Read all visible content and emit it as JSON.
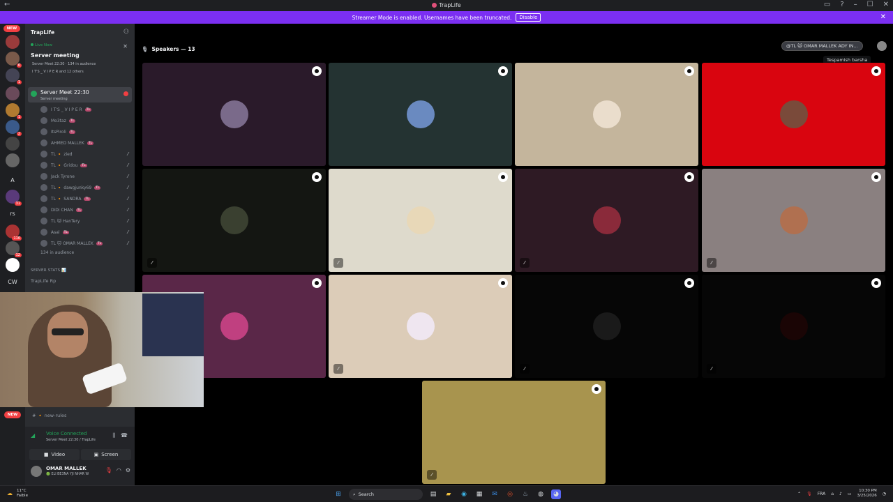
{
  "window": {
    "title": "TrapLife"
  },
  "banner": {
    "text": "Streamer Mode is enabled. Usernames have been truncated.",
    "disable_label": "Disable"
  },
  "guilds": [
    {
      "label": "",
      "badge": "",
      "color": "#9a3b3b"
    },
    {
      "label": "",
      "badge": "6",
      "color": "#7a5a4a"
    },
    {
      "label": "",
      "badge": "1",
      "color": "#445"
    },
    {
      "label": "",
      "badge": "",
      "color": "#6a4a5a"
    },
    {
      "label": "",
      "badge": "1",
      "color": "#b07a30"
    },
    {
      "label": "",
      "badge": "2",
      "color": "#3a5a8a"
    },
    {
      "label": "",
      "badge": "",
      "color": "#444"
    },
    {
      "label": "",
      "badge": "",
      "color": "#666"
    },
    {
      "label": "A",
      "badge": "",
      "color": "#1e1f22"
    },
    {
      "label": "",
      "badge": "31",
      "color": "#5a3a7a"
    },
    {
      "label": "rs",
      "badge": "",
      "color": "#1e1f22"
    },
    {
      "label": "",
      "badge": "116",
      "color": "#a33"
    },
    {
      "label": "",
      "badge": "12",
      "color": "#555"
    },
    {
      "label": "",
      "badge": "",
      "color": "#fff"
    },
    {
      "label": "CW",
      "badge": "",
      "color": "#1e1f22"
    }
  ],
  "guild_new_label": "NEW",
  "sidebar": {
    "server_name": "TrapLife",
    "live_label": "Live Now",
    "stage_title": "Server meeting",
    "stage_meta": "Server Meet 22:30 · 134 in audience",
    "stage_users": "I T'S _ V I P E R and 12 others",
    "voice_channel": {
      "name": "Server Meet 22:30",
      "sub": "Server meeting"
    },
    "members": [
      {
        "name": "I T'S _ V I P E R",
        "tag": "TL",
        "muted": false
      },
      {
        "name": "Mo3taz",
        "tag": "TL",
        "muted": false
      },
      {
        "name": "ItsPiroli",
        "tag": "TL",
        "muted": false
      },
      {
        "name": "AHMED MALLEK",
        "tag": "TL",
        "muted": false
      },
      {
        "name": "TL 🔸 zied",
        "tag": "",
        "muted": true
      },
      {
        "name": "TL 🔸 Gridou",
        "tag": "TL",
        "muted": true
      },
      {
        "name": "Jack Tyrone",
        "tag": "",
        "muted": true
      },
      {
        "name": "TL 🔸 dawgjunky69",
        "tag": "TL",
        "muted": true
      },
      {
        "name": "TL 🔸 SANDRA",
        "tag": "TL",
        "muted": true
      },
      {
        "name": "DiDi CHAN",
        "tag": "TL",
        "muted": true
      },
      {
        "name": "TL 🐱 HanTery",
        "tag": "",
        "muted": true
      },
      {
        "name": "Asal",
        "tag": "TL",
        "muted": true
      },
      {
        "name": "TL 🐱 OMAR MALLEK",
        "tag": "TL",
        "muted": true
      }
    ],
    "audience": "134 in audience",
    "category": "SERVER STATS 📊",
    "channel1": "TrapLife Rp",
    "channel_text": "# 🔸 new-rules",
    "voice_status": "Voice Connected",
    "voice_sub": "Server Meet 22:30 / TrapLife",
    "video_label": "Video",
    "screen_label": "Screen",
    "user_name": "OMAR MALLEK",
    "user_status": "🟢 ELI BE3NA YJI NHAR W"
  },
  "main": {
    "speakers_label": "Speakers — 13",
    "top_pill": "@TL 🐱 OMAR MALLEK ADY IN...",
    "tooltip": "Tespamish barsha"
  },
  "tiles": [
    {
      "bg": "#2a1a2a",
      "av": "#7a6a8a",
      "muted": false
    },
    {
      "bg": "#243332",
      "av": "#6a8ac0",
      "muted": false
    },
    {
      "bg": "#c4b59c",
      "av": "#eaddcc",
      "muted": false
    },
    {
      "bg": "#d9050f",
      "av": "#7a4a3a",
      "muted": false
    },
    {
      "bg": "#141612",
      "av": "#3a4030",
      "muted": true
    },
    {
      "bg": "#dedacc",
      "av": "#e8d8b8",
      "muted": true
    },
    {
      "bg": "#2e1a24",
      "av": "#8a2a3a",
      "muted": true
    },
    {
      "bg": "#8a8080",
      "av": "#b07050",
      "muted": true
    },
    {
      "bg": "#5a2748",
      "av": "#c04080",
      "muted": false
    },
    {
      "bg": "#dcccb8",
      "av": "#efe6f0",
      "muted": true
    },
    {
      "bg": "#060606",
      "av": "#1a1a1a",
      "muted": true
    },
    {
      "bg": "#060606",
      "av": "#1a0505",
      "muted": true
    },
    {
      "bg": "#a8944e",
      "av": "#a8944e",
      "muted": true
    }
  ],
  "taskbar": {
    "weather_temp": "11°C",
    "weather_desc": "Faible",
    "search_label": "Search",
    "lang": "FRA",
    "time": "10:30 PM",
    "date": "3/25/2026"
  }
}
